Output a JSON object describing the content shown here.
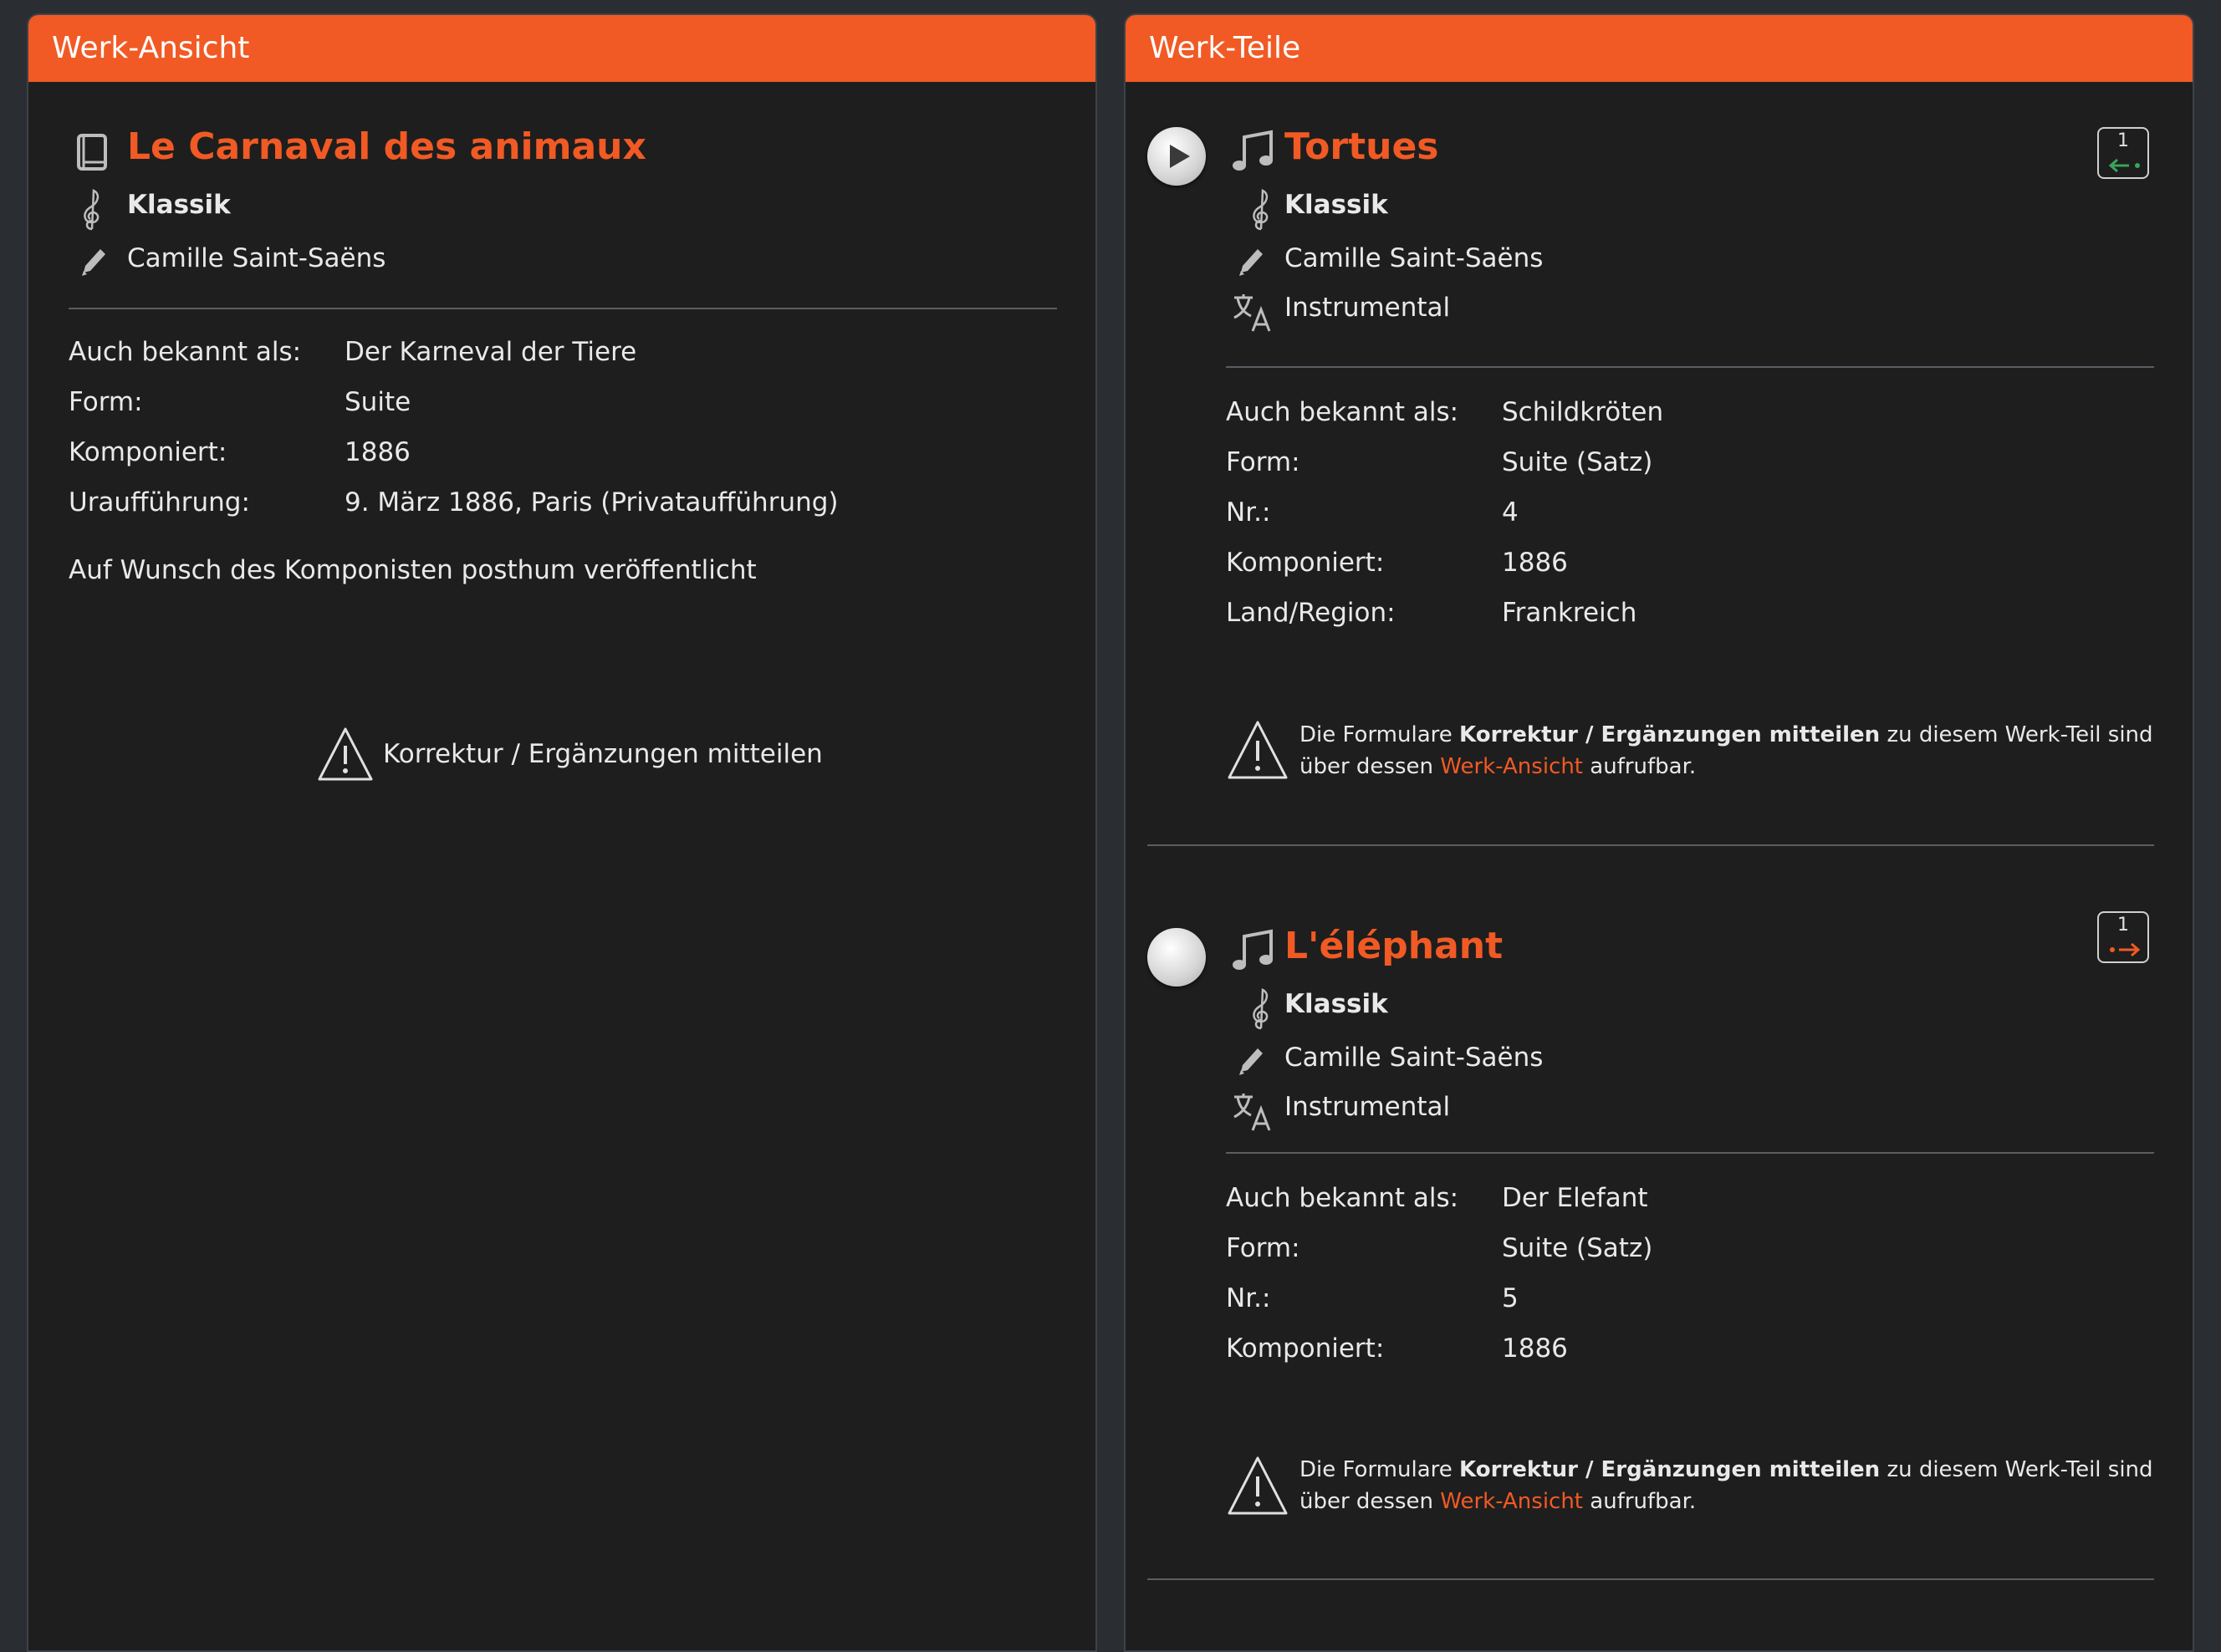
{
  "left": {
    "header": "Werk-Ansicht",
    "title": "Le Carnaval des animaux",
    "genre": "Klassik",
    "composer": "Camille Saint-Saëns",
    "details": [
      {
        "label": "Auch bekannt als:",
        "value": "Der Karneval der Tiere"
      },
      {
        "label": "Form:",
        "value": "Suite"
      },
      {
        "label": "Komponiert:",
        "value": "1886"
      },
      {
        "label": "Uraufführung:",
        "value": "9. März 1886, Paris (Privataufführung)"
      }
    ],
    "note": "Auf Wunsch des Komponisten posthum veröffentlicht",
    "report_link": "Korrektur / Ergänzungen mitteilen"
  },
  "right": {
    "header": "Werk-Teile",
    "parts": [
      {
        "title": "Tortues",
        "genre": "Klassik",
        "composer": "Camille Saint-Saëns",
        "language": "Instrumental",
        "badge_number": "1",
        "details": [
          {
            "label": "Auch bekannt als:",
            "value": "Schildkröten"
          },
          {
            "label": "Form:",
            "value": "Suite (Satz)"
          },
          {
            "label": "Nr.:",
            "value": "4"
          },
          {
            "label": "Komponiert:",
            "value": "1886"
          },
          {
            "label": "Land/Region:",
            "value": "Frankreich"
          }
        ],
        "notice": {
          "prefix": "Die Formulare",
          "bold": "Korrektur / Ergänzungen mitteilen",
          "mid": "zu diesem Werk-Teil sind",
          "line2_prefix": "über dessen",
          "link": "Werk-Ansicht",
          "suffix": "aufrufbar."
        }
      },
      {
        "title": "L'éléphant",
        "genre": "Klassik",
        "composer": "Camille Saint-Saëns",
        "language": "Instrumental",
        "badge_number": "1",
        "details": [
          {
            "label": "Auch bekannt als:",
            "value": "Der Elefant"
          },
          {
            "label": "Form:",
            "value": "Suite (Satz)"
          },
          {
            "label": "Nr.:",
            "value": "5"
          },
          {
            "label": "Komponiert:",
            "value": "1886"
          }
        ],
        "notice": {
          "prefix": "Die Formulare",
          "bold": "Korrektur / Ergänzungen mitteilen",
          "mid": "zu diesem Werk-Teil sind",
          "line2_prefix": "über dessen",
          "link": "Werk-Ansicht",
          "suffix": "aufrufbar."
        }
      }
    ]
  },
  "icons": {
    "book": "book-icon",
    "clef": "treble-clef-icon",
    "pencil": "pencil-icon",
    "note": "music-note-icon",
    "translate": "translate-icon",
    "warning": "warning-icon",
    "play": "play-button-icon"
  },
  "colors": {
    "accent": "#f15a24",
    "background": "#1e1e1e",
    "page": "#2a2d32",
    "green": "#3aa35c"
  }
}
